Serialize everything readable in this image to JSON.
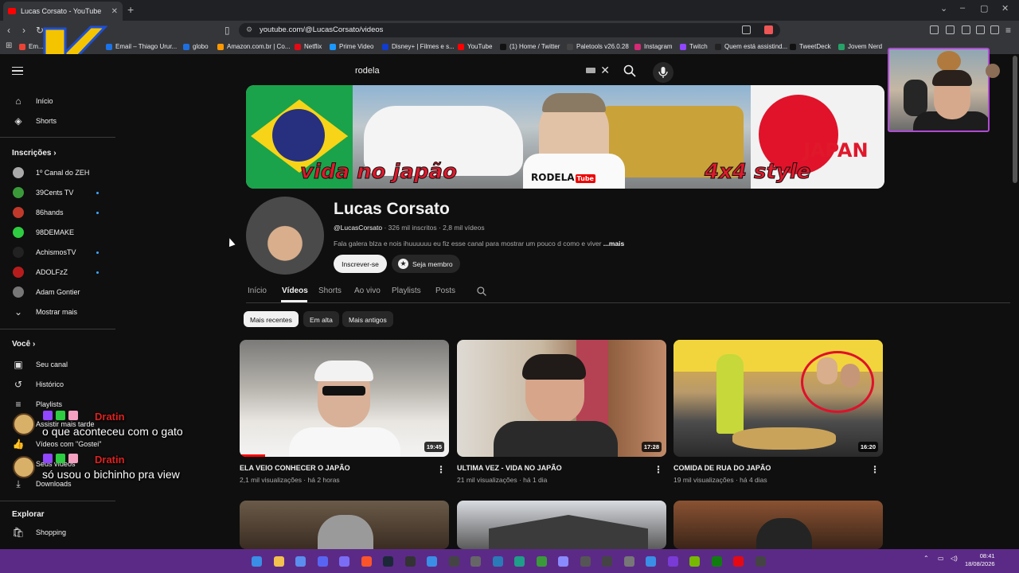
{
  "browser": {
    "tab_title": "Lucas Corsato - YouTube",
    "url": "youtube.com/@LucasCorsato/videos",
    "bookmarks": [
      {
        "label": "Em...",
        "color": "#ea4335"
      },
      {
        "label": "Email – Thiago Urur...",
        "color": "#1a73e8"
      },
      {
        "label": "globo",
        "color": "#1d6fe0"
      },
      {
        "label": "Amazon.com.br | Co...",
        "color": "#ff9900"
      },
      {
        "label": "Netflix",
        "color": "#e50914"
      },
      {
        "label": "Prime Video",
        "color": "#1a98ff"
      },
      {
        "label": "Disney+ | Filmes e s...",
        "color": "#113ccf"
      },
      {
        "label": "YouTube",
        "color": "#ff0000"
      },
      {
        "label": "(1) Home / Twitter",
        "color": "#111111"
      },
      {
        "label": "Paletools v26.0.28",
        "color": "#444444"
      },
      {
        "label": "Instagram",
        "color": "#d62976"
      },
      {
        "label": "Twitch",
        "color": "#9146ff"
      },
      {
        "label": "Quem está assistind...",
        "color": "#222222"
      },
      {
        "label": "TweetDeck",
        "color": "#111111"
      },
      {
        "label": "Jovem Nerd",
        "color": "#26a269"
      }
    ]
  },
  "search": {
    "query": "rodela"
  },
  "sidebar": {
    "top": [
      {
        "label": "Início",
        "icon": "home-icon"
      },
      {
        "label": "Shorts",
        "icon": "shorts-icon"
      }
    ],
    "subscriptions_title": "Inscrições",
    "subscriptions": [
      {
        "label": "1º Canal do ZEH",
        "color": "#aaaaaa",
        "dot": false
      },
      {
        "label": "39Cents TV",
        "color": "#3a9a3a",
        "dot": true
      },
      {
        "label": "86hands",
        "color": "#c0392b",
        "dot": true
      },
      {
        "label": "98DEMAKE",
        "color": "#2ecc40",
        "dot": false
      },
      {
        "label": "AchismosTV",
        "color": "#222222",
        "dot": true
      },
      {
        "label": "ADOLFzZ",
        "color": "#b71c1c",
        "dot": true
      },
      {
        "label": "Adam Gontier",
        "color": "#777777",
        "dot": false
      }
    ],
    "show_more": "Mostrar mais",
    "you_title": "Você",
    "you_items": [
      {
        "label": "Seu canal",
        "icon": "channel-icon"
      },
      {
        "label": "Histórico",
        "icon": "history-icon"
      },
      {
        "label": "Playlists",
        "icon": "playlists-icon"
      },
      {
        "label": "Assistir mais tarde",
        "icon": "watch-later-icon"
      },
      {
        "label": "Vídeos com \"Gostei\"",
        "icon": "like-icon"
      },
      {
        "label": "Seus vídeos",
        "icon": "your-videos-icon"
      },
      {
        "label": "Downloads",
        "icon": "download-icon"
      }
    ],
    "explore_title": "Explorar",
    "explore_items": [
      {
        "label": "Shopping",
        "icon": "shopping-icon"
      }
    ]
  },
  "chat": [
    {
      "name": "Dratin",
      "message": "o que aconteceu com o gato"
    },
    {
      "name": "Dratin",
      "message": "só usou o bichinho pra view"
    }
  ],
  "banner": {
    "text_left": "vida no japão",
    "text_center": "RODELA",
    "text_center_tag": "Tube",
    "text_right": "4x4 style",
    "text_japan": "JAPAN"
  },
  "channel": {
    "name": "Lucas Corsato",
    "handle": "@LucasCorsato",
    "stats": "· 326 mil inscritos · 2,8 mil vídeos",
    "description": "Fala galera blza e nois ihuuuuuu eu fiz esse canal para mostrar um pouco d como e viver",
    "more": "...mais",
    "subscribe": "Inscrever-se",
    "member": "Seja membro"
  },
  "tabs": [
    "Início",
    "Vídeos",
    "Shorts",
    "Ao vivo",
    "Playlists",
    "Posts"
  ],
  "active_tab": "Vídeos",
  "chips": [
    "Mais recentes",
    "Em alta",
    "Mais antigos"
  ],
  "videos": [
    {
      "title": "ELA VEIO CONHECER O JAPÃO",
      "meta": "2,1 mil visualizações · há 2 horas",
      "duration": "19:45",
      "progress": 0.12
    },
    {
      "title": "ULTIMA VEZ - VIDA NO JAPÃO",
      "meta": "21 mil visualizações · há 1 dia",
      "duration": "17:28",
      "progress": 0.0
    },
    {
      "title": "COMIDA DE RUA DO JAPÃO",
      "meta": "19 mil visualizações · há 4 dias",
      "duration": "16:20",
      "progress": 0.0
    }
  ],
  "clock": {
    "time": "08:41",
    "date": "18/08/2026"
  },
  "colors": {
    "accent": "#ff0000",
    "taskbar": "#5b2a86",
    "chat_name": "#e02020"
  }
}
